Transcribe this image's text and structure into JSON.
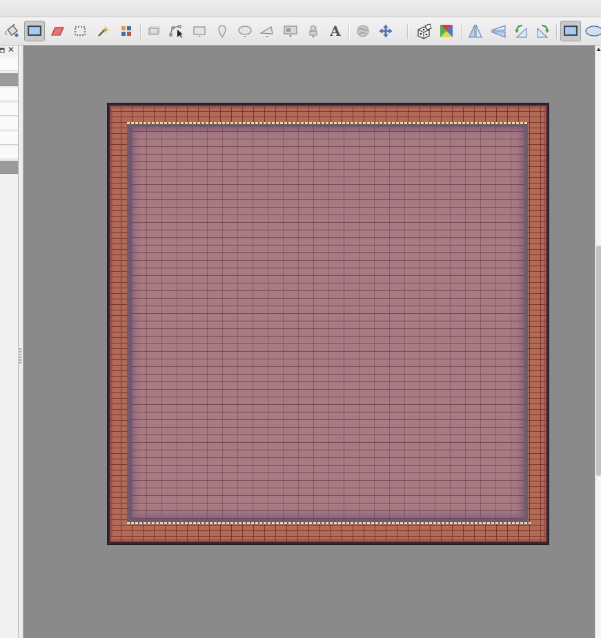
{
  "toolbar": {
    "buttons": [
      {
        "icon": "bucket-fill-icon",
        "active": false
      },
      {
        "icon": "stamp-brush-icon",
        "active": true
      },
      {
        "icon": "eraser-icon",
        "active": false
      },
      {
        "icon": "rectangle-select-icon",
        "active": false
      },
      {
        "icon": "magic-wand-icon",
        "active": false
      },
      {
        "icon": "select-same-tile-icon",
        "active": false
      },
      {
        "icon": "select-objects-icon",
        "active": false
      },
      {
        "icon": "edit-polygons-icon",
        "active": false
      },
      {
        "icon": "insert-rectangle-icon",
        "active": false
      },
      {
        "icon": "insert-point-icon",
        "active": false
      },
      {
        "icon": "insert-ellipse-icon",
        "active": false
      },
      {
        "icon": "insert-polygon-icon",
        "active": false
      },
      {
        "icon": "insert-tile-icon",
        "active": false
      },
      {
        "icon": "insert-template-icon",
        "active": false
      },
      {
        "icon": "insert-text-icon",
        "active": false
      },
      {
        "icon": "world-tool-icon",
        "active": false
      },
      {
        "icon": "move-icon",
        "active": false
      },
      {
        "icon": "random-mode-icon",
        "active": false
      },
      {
        "icon": "wang-fill-icon",
        "active": false
      },
      {
        "icon": "flip-horizontal-icon",
        "active": false
      },
      {
        "icon": "flip-vertical-icon",
        "active": false
      },
      {
        "icon": "rotate-left-icon",
        "active": false
      },
      {
        "icon": "rotate-right-icon",
        "active": false
      },
      {
        "icon": "rectangle-shape-icon",
        "active": true
      },
      {
        "icon": "ellipse-shape-icon",
        "active": false
      }
    ],
    "text_tool_glyph": "A"
  },
  "panel": {
    "float_icon": "float-panel-icon",
    "close_icon": "close-icon",
    "close_glyph": "✕"
  },
  "colors": {
    "workspace": "#8a8a8a",
    "wall_brick": "#b56a56",
    "floor_tile": "#a87a82",
    "accent_blue": "#4a7fc0"
  }
}
